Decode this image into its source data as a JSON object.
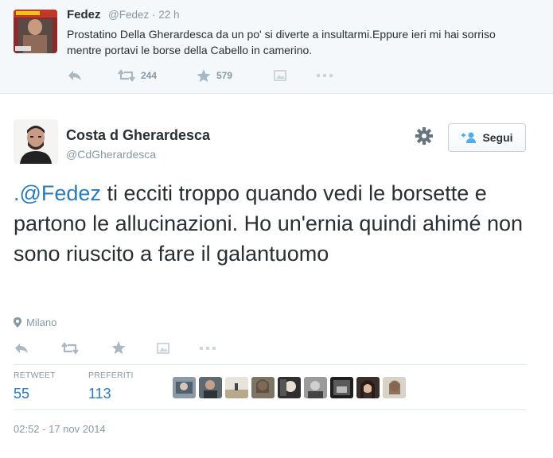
{
  "parent_tweet": {
    "author_name": "Fedez",
    "meta": "@Fedez · 22 h",
    "text": "Prostatino Della Gherardesca da un po' si diverte a insultarmi.Eppure ieri mi hai sorriso mentre portavi le borse della Cabello in camerino.",
    "retweet_count": "244",
    "favorite_count": "579",
    "icons": [
      "reply-icon",
      "retweet-icon",
      "star-icon",
      "image-icon",
      "more-icon"
    ]
  },
  "main_tweet": {
    "author_name": "Costa d Gherardesca",
    "author_handle": "@CdGherardesca",
    "follow_label": "Segui",
    "mention": ".@Fedez",
    "text": " ti ecciti troppo quando vedi le borsette e partono le allucinazioni. Ho un'ernia quindi ahimé non sono riuscito a fare il galantuomo",
    "location": "Milano",
    "stats": {
      "retweet_label": "RETWEET",
      "retweet_value": "55",
      "favorites_label": "PREFERITI",
      "favorites_value": "113"
    },
    "timestamp": "02:52 - 17 nov 2014",
    "icons": [
      "settings-gear-icon",
      "follow-person-icon",
      "location-pin-icon",
      "reply-icon",
      "retweet-icon",
      "star-icon",
      "image-icon",
      "more-icon"
    ]
  },
  "colors": {
    "link": "#2b7bb9",
    "muted": "#8899a6",
    "text": "#292f33",
    "parent_background": "#f5f8fa",
    "divider": "#e1e8ed"
  },
  "favoriters_count_shown": 9
}
